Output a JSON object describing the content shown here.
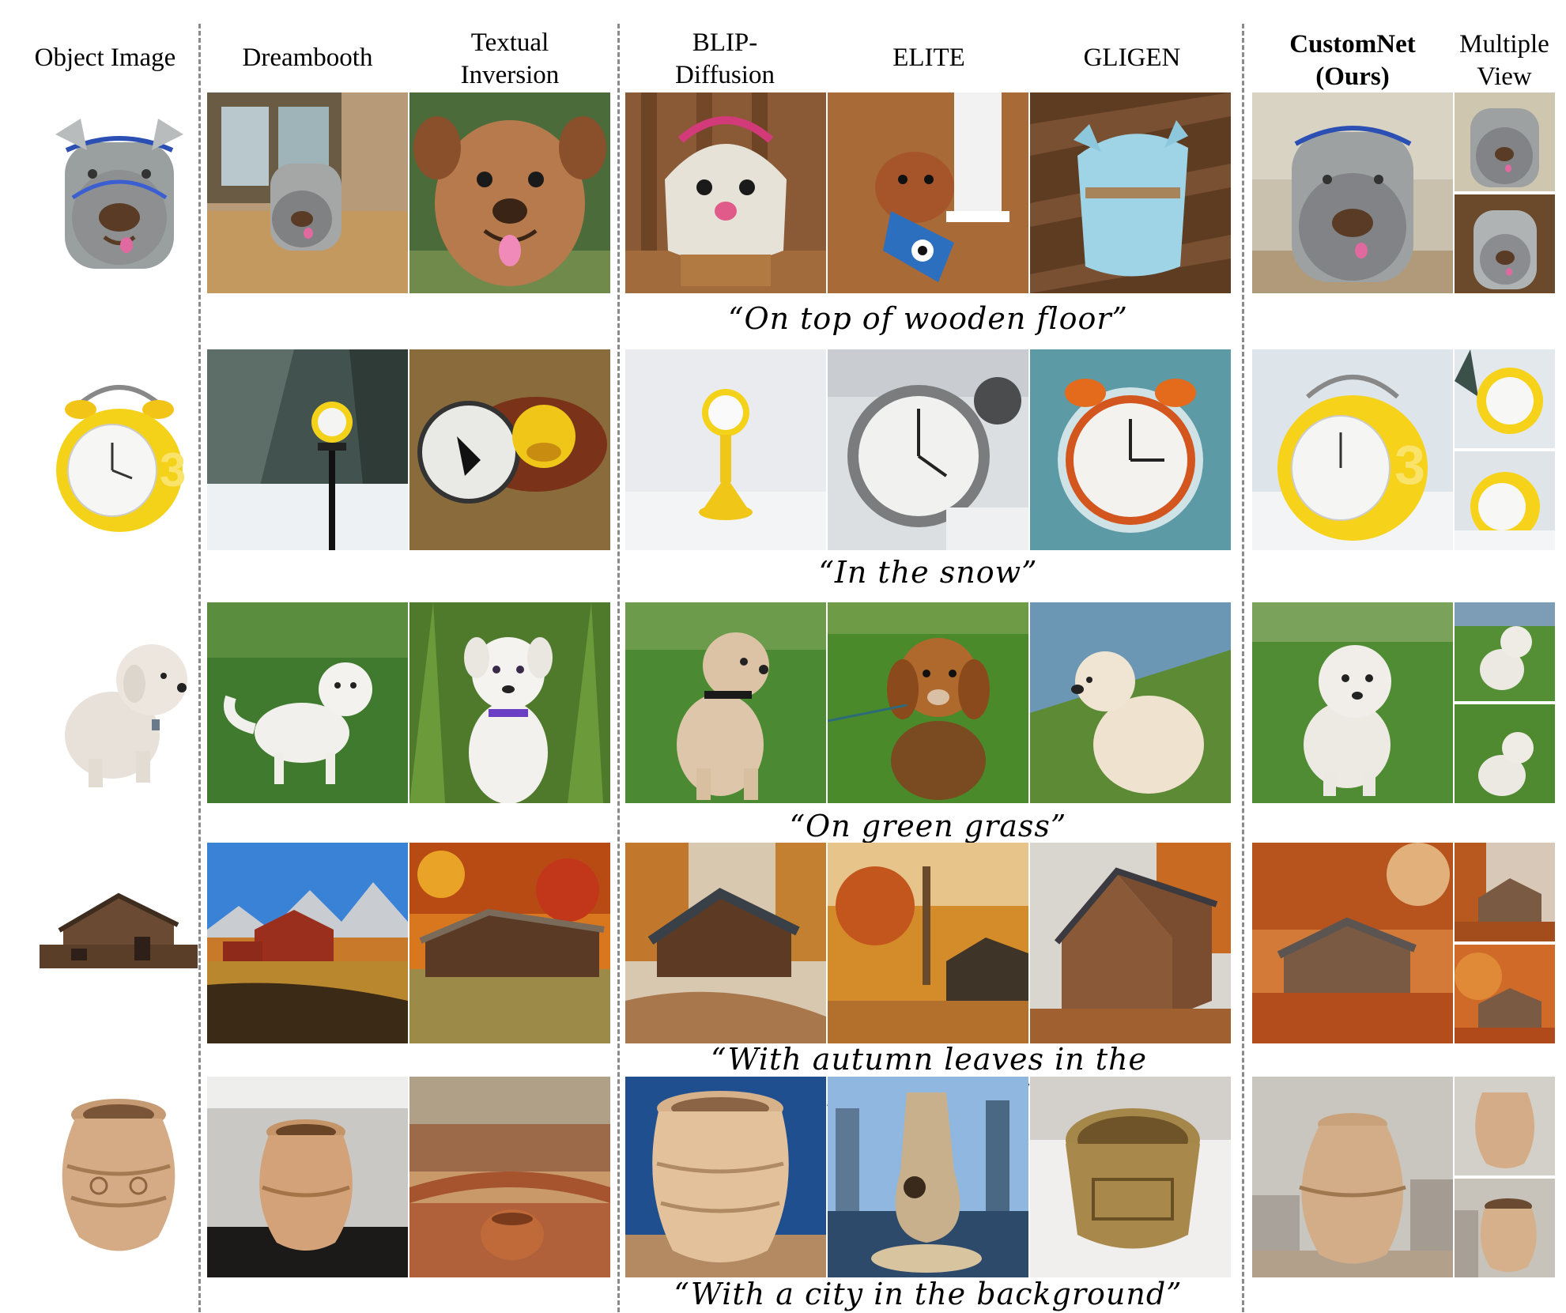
{
  "headers": {
    "object": "Object Image",
    "dreambooth": "Dreambooth",
    "textual_1": "Textual",
    "textual_2": "Inversion",
    "blip_1": "BLIP-",
    "blip_2": "Diffusion",
    "elite": "ELITE",
    "gligen": "GLIGEN",
    "customnet_1": "CustomNet",
    "customnet_2": "(Ours)",
    "multiple_1": "Multiple",
    "multiple_2": "View"
  },
  "prompts": [
    "“On top of wooden floor”",
    "“In the snow”",
    "“On green grass”",
    "“With autumn leaves in the background”",
    "“With a city in the background”"
  ],
  "rows": [
    {
      "subject": "backpack"
    },
    {
      "subject": "alarm clock"
    },
    {
      "subject": "dog"
    },
    {
      "subject": "barn"
    },
    {
      "subject": "vase"
    }
  ]
}
